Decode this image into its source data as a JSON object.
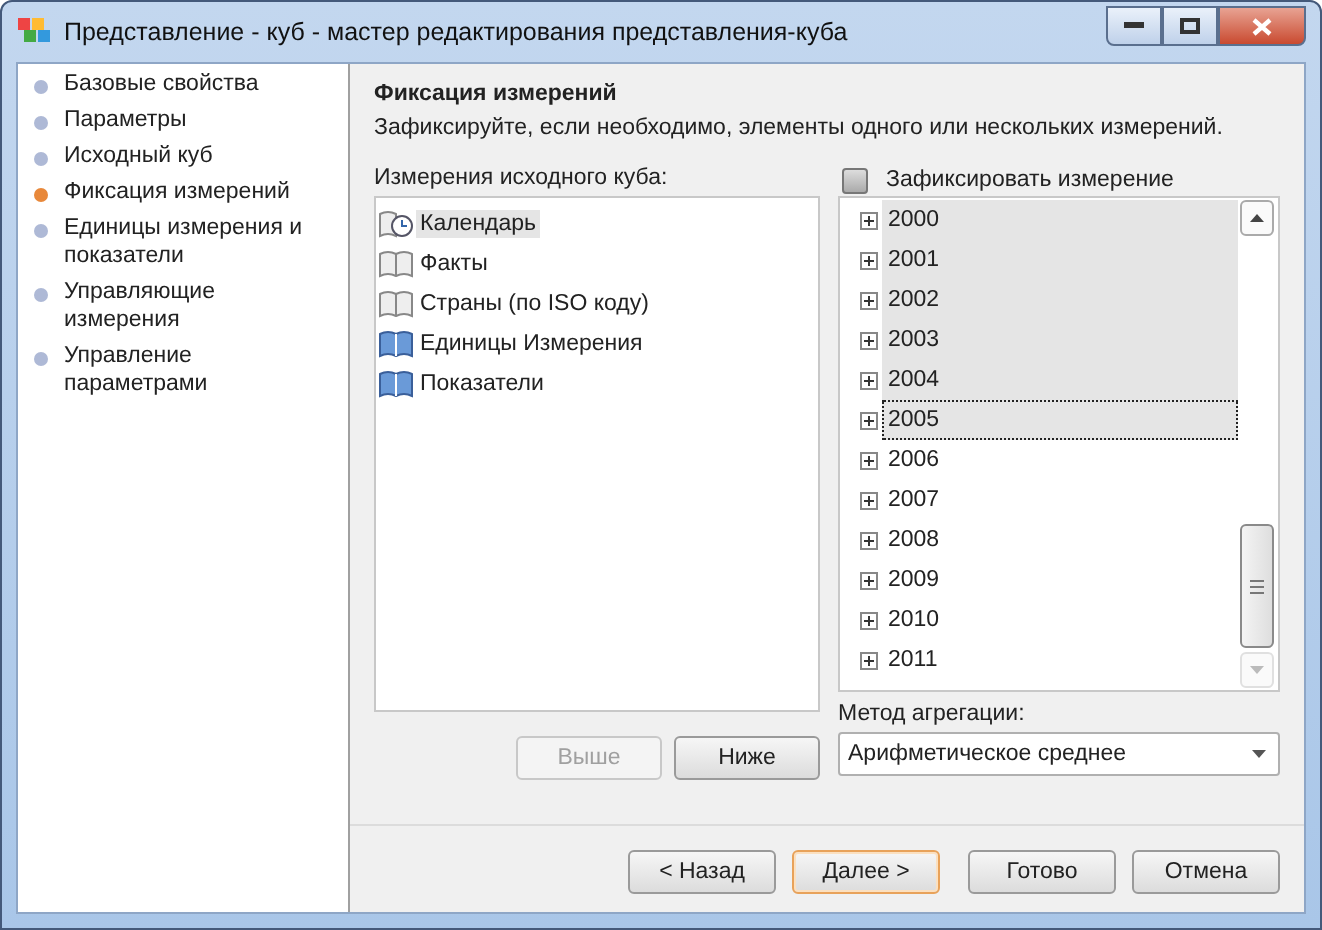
{
  "window": {
    "title": "Представление - куб - мастер редактирования представления-куба"
  },
  "sidebar": {
    "items": [
      {
        "label": "Базовые свойства",
        "selected": false
      },
      {
        "label": "Параметры",
        "selected": false
      },
      {
        "label": "Исходный куб",
        "selected": false
      },
      {
        "label": "Фиксация измерений",
        "selected": true
      },
      {
        "label": "Единицы измерения и показатели",
        "selected": false
      },
      {
        "label": "Управляющие измерения",
        "selected": false
      },
      {
        "label": "Управление параметрами",
        "selected": false
      }
    ]
  },
  "page": {
    "heading": "Фиксация измерений",
    "description": "Зафиксируйте, если необходимо, элементы одного или нескольких измерений."
  },
  "dimensions": {
    "label": "Измерения исходного куба:",
    "items": [
      {
        "label": "Календарь",
        "kind": "calendar",
        "selected": true
      },
      {
        "label": "Факты",
        "kind": "book",
        "selected": false
      },
      {
        "label": "Страны (по ISO коду)",
        "kind": "book",
        "selected": false
      },
      {
        "label": "Единицы Измерения",
        "kind": "book-blue",
        "selected": false
      },
      {
        "label": "Показатели",
        "kind": "book-blue",
        "selected": false
      }
    ]
  },
  "move_buttons": [
    {
      "label": "Выше",
      "disabled": true
    },
    {
      "label": "Ниже",
      "disabled": false
    }
  ],
  "fix_checkbox": {
    "label": "Зафиксировать измерение",
    "checked": false
  },
  "elements": {
    "items": [
      {
        "label": "2000",
        "selected": true,
        "focused": false
      },
      {
        "label": "2001",
        "selected": true,
        "focused": false
      },
      {
        "label": "2002",
        "selected": true,
        "focused": false
      },
      {
        "label": "2003",
        "selected": true,
        "focused": false
      },
      {
        "label": "2004",
        "selected": true,
        "focused": false
      },
      {
        "label": "2005",
        "selected": true,
        "focused": true
      },
      {
        "label": "2006",
        "selected": false,
        "focused": false
      },
      {
        "label": "2007",
        "selected": false,
        "focused": false
      },
      {
        "label": "2008",
        "selected": false,
        "focused": false
      },
      {
        "label": "2009",
        "selected": false,
        "focused": false
      },
      {
        "label": "2010",
        "selected": false,
        "focused": false
      },
      {
        "label": "2011",
        "selected": false,
        "focused": false
      }
    ]
  },
  "aggregation": {
    "label": "Метод агрегации:",
    "value": "Арифметическое среднее"
  },
  "footer_buttons": [
    {
      "label": "< Назад",
      "default": false
    },
    {
      "label": "Далее >",
      "default": true
    },
    {
      "label": "Готово",
      "default": false
    },
    {
      "label": "Отмена",
      "default": false
    }
  ]
}
